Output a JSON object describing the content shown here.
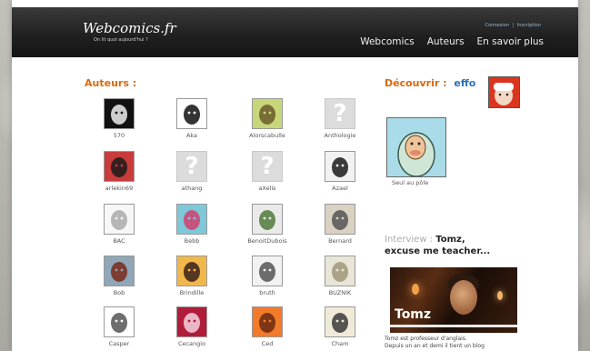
{
  "header": {
    "logo": "Webcomics.fr",
    "tagline": "On lit quoi aujourd'hui ?",
    "auth_login": "Connexion",
    "auth_sep": "|",
    "auth_signup": "Inscription",
    "nav": [
      "Webcomics",
      "Auteurs",
      "En savoir plus"
    ]
  },
  "authors": {
    "title": "Auteurs :",
    "items": [
      {
        "name": "570",
        "icon": "author-570-icon"
      },
      {
        "name": "Aka",
        "icon": "author-aka-icon"
      },
      {
        "name": "Alorscabulle",
        "icon": "author-alorscabulle-icon"
      },
      {
        "name": "Anthologie",
        "icon": "placeholder-question-icon"
      },
      {
        "name": "arlekin69",
        "icon": "author-arlekin69-icon"
      },
      {
        "name": "athang",
        "icon": "placeholder-question-icon"
      },
      {
        "name": "aXelis",
        "icon": "placeholder-question-icon"
      },
      {
        "name": "Azael",
        "icon": "author-azael-icon"
      },
      {
        "name": "BAC",
        "icon": "author-bac-icon"
      },
      {
        "name": "Bebb",
        "icon": "author-bebb-icon"
      },
      {
        "name": "BenoitDubois",
        "icon": "author-benoitdubois-icon"
      },
      {
        "name": "Bernard",
        "icon": "author-bernard-icon"
      },
      {
        "name": "Bob",
        "icon": "author-bob-icon"
      },
      {
        "name": "Brindille",
        "icon": "author-brindille-icon"
      },
      {
        "name": "bruth",
        "icon": "author-bruth-icon"
      },
      {
        "name": "BUZNIK",
        "icon": "author-buznik-icon"
      },
      {
        "name": "Casper",
        "icon": "author-casper-icon"
      },
      {
        "name": "Cecangio",
        "icon": "author-cecangio-icon"
      },
      {
        "name": "Ced",
        "icon": "author-ced-icon"
      },
      {
        "name": "Cham",
        "icon": "author-cham-icon"
      }
    ]
  },
  "discover": {
    "label": "Découvrir :",
    "author": "effo",
    "comic_caption": "Seul au pôle"
  },
  "interview": {
    "label": "Interview :",
    "name": "Tomz,",
    "subtitle": "excuse me teacher...",
    "photo_name": "Tomz",
    "desc_line1": "Tomz est professeur d'anglais.",
    "desc_line2": "Depuis un an et demi il tient un blog"
  },
  "colors": {
    "accent": "#d66a12",
    "link": "#2f6fb5",
    "header": "#1f1f1f"
  }
}
